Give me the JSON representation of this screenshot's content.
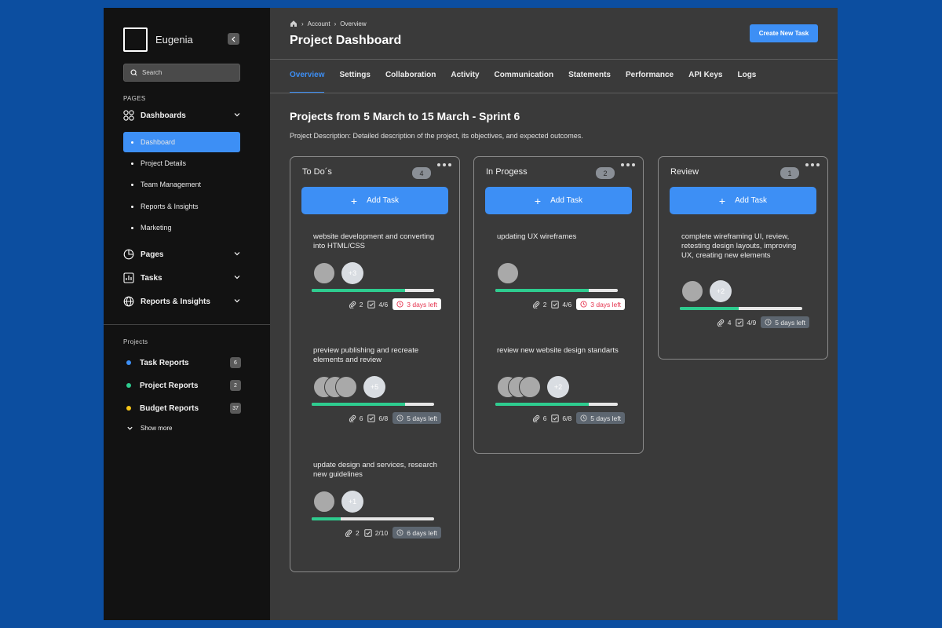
{
  "sidebar": {
    "brand": "Eugenia",
    "search_placeholder": "Search",
    "pages_label": "PAGES",
    "groups": {
      "dashboards": "Dashboards",
      "pages": "Pages",
      "tasks": "Tasks",
      "reports": "Reports & Insights"
    },
    "dashboard_items": [
      "Dashboard",
      "Project Details",
      "Team Management",
      "Reports & Insights",
      "Marketing"
    ],
    "projects_label": "Projects",
    "projects": [
      {
        "label": "Task Reports",
        "count": "6",
        "color": "#3d8ff5"
      },
      {
        "label": "Project Reports",
        "count": "2",
        "color": "#2ecc8f"
      },
      {
        "label": "Budget Reports",
        "count": "37",
        "color": "#f5c518"
      }
    ],
    "show_more": "Show more"
  },
  "header": {
    "breadcrumb": [
      "Account",
      "Overview"
    ],
    "title": "Project Dashboard",
    "create_button": "Create New Task"
  },
  "tabs": [
    "Overview",
    "Settings",
    "Collaboration",
    "Activity",
    "Communication",
    "Statements",
    "Performance",
    "API Keys",
    "Logs"
  ],
  "section": {
    "title": "Projects from 5 March to 15 March - Sprint 6",
    "description": "Project Description: Detailed description of the project, its objectives, and expected outcomes."
  },
  "add_task_label": "Add Task",
  "columns": [
    {
      "title": "To Do´s",
      "count": "4",
      "cards": [
        {
          "text": "website development and converting into HTML/CSS",
          "more": "+3",
          "attachments": "2",
          "checks": "4/6",
          "days": "3 days left",
          "urgent": true,
          "progress": 0.76
        },
        {
          "text": "preview publishing and recreate elements and review",
          "more": "+5",
          "attachments": "6",
          "checks": "6/8",
          "days": "5 days left",
          "urgent": false,
          "progress": 0.76
        },
        {
          "text": "update design and services, research new guidelines",
          "more": "+1",
          "attachments": "2",
          "checks": "2/10",
          "days": "6 days left",
          "urgent": false,
          "progress": 0.24
        }
      ]
    },
    {
      "title": "In Progess",
      "count": "2",
      "cards": [
        {
          "text": "updating UX wireframes",
          "more": "",
          "attachments": "2",
          "checks": "4/6",
          "days": "3 days left",
          "urgent": true,
          "progress": 0.76
        },
        {
          "text": "review new website design standarts",
          "more": "+2",
          "attachments": "6",
          "checks": "6/8",
          "days": "5 days left",
          "urgent": false,
          "progress": 0.76
        }
      ]
    },
    {
      "title": "Review",
      "count": "1",
      "cards": [
        {
          "text": "complete wireframing UI, review, retesting design layouts, improving UX, creating new elements",
          "more": "+2",
          "attachments": "4",
          "checks": "4/9",
          "days": "5 days left",
          "urgent": false,
          "progress": 0.48
        }
      ]
    }
  ]
}
